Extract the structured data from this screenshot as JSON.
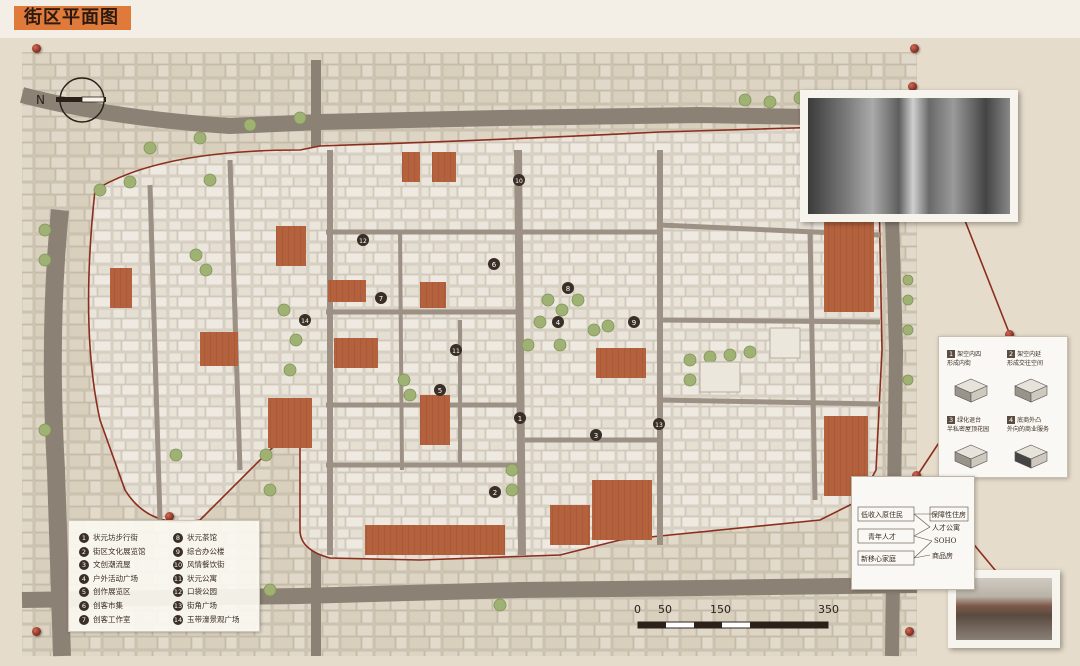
{
  "title": "街区平面图",
  "compass": {
    "label": "N"
  },
  "legend": {
    "col1": [
      {
        "n": "1",
        "label": "状元坊步行街"
      },
      {
        "n": "2",
        "label": "街区文化展览馆"
      },
      {
        "n": "3",
        "label": "文创潮流屋"
      },
      {
        "n": "4",
        "label": "户外活动广场"
      },
      {
        "n": "5",
        "label": "创作展览区"
      },
      {
        "n": "6",
        "label": "创客市集"
      },
      {
        "n": "7",
        "label": "创客工作室"
      }
    ],
    "col2": [
      {
        "n": "8",
        "label": "状元茶馆"
      },
      {
        "n": "9",
        "label": "综合办公楼"
      },
      {
        "n": "10",
        "label": "风情餐饮街"
      },
      {
        "n": "11",
        "label": "状元公寓"
      },
      {
        "n": "12",
        "label": "口袋公园"
      },
      {
        "n": "13",
        "label": "街角广场"
      },
      {
        "n": "14",
        "label": "玉带濠景观广场"
      }
    ]
  },
  "map_markers": [
    "1",
    "2",
    "3",
    "4",
    "5",
    "6",
    "7",
    "8",
    "9",
    "10",
    "11",
    "12",
    "13",
    "14"
  ],
  "scale": {
    "labels": [
      "0",
      "50",
      "150",
      "350"
    ]
  },
  "callout": {
    "left": [
      "低收入原住民",
      "青年人才",
      "新移心家庭"
    ],
    "right": [
      "保障性住房",
      "人才公寓",
      "SOHO",
      "商品房"
    ]
  },
  "diagram": {
    "items": [
      {
        "num": "1",
        "title": "架空内四",
        "sub": "形成内街"
      },
      {
        "num": "2",
        "title": "架空内延",
        "sub": "形成交往空间"
      },
      {
        "num": "3",
        "title": "绿化退台",
        "sub": "半私密屋顶花园"
      },
      {
        "num": "4",
        "title": "底商外凸",
        "sub": "外向的商业服务"
      }
    ]
  },
  "colors": {
    "accent": "#e07a3a",
    "brick": "#b5633f",
    "route": "#8b2e1e",
    "road": "#8c8175",
    "block": "#d9d2c6",
    "green": "#9fb274"
  }
}
